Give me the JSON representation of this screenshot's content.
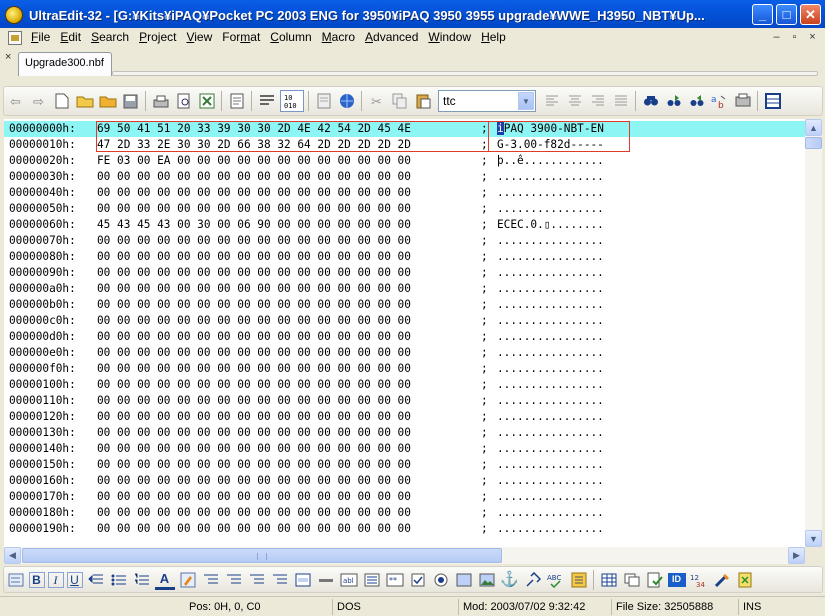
{
  "window": {
    "title": "UltraEdit-32 - [G:¥Kits¥iPAQ¥Pocket PC 2003 ENG for 3950¥iPAQ 3950 3955 upgrade¥WWE_H3950_NBT¥Up..."
  },
  "window_buttons": {
    "minimize": "_",
    "maximize": "□",
    "close": "✕"
  },
  "menu": [
    "File",
    "Edit",
    "Search",
    "Project",
    "View",
    "Format",
    "Column",
    "Macro",
    "Advanced",
    "Window",
    "Help"
  ],
  "menu_accel": [
    "F",
    "E",
    "S",
    "P",
    "V",
    "m",
    "C",
    "M",
    "A",
    "W",
    "H"
  ],
  "mdi_buttons": [
    "–",
    "▫",
    "×"
  ],
  "tab": {
    "close": "×",
    "label": "Upgrade300.nbf"
  },
  "find": {
    "value": "ttc"
  },
  "hex": {
    "separator": ";",
    "rows": [
      {
        "offset": "00000000h:",
        "bytes": "69 50 41 51 20 33 39 30 30 2D 4E 42 54 2D 45 4E",
        "ascii": "iPAQ 3900-NBT-EN"
      },
      {
        "offset": "00000010h:",
        "bytes": "47 2D 33 2E 30 30 2D 66 38 32 64 2D 2D 2D 2D 2D",
        "ascii": "G-3.00-f82d-----"
      },
      {
        "offset": "00000020h:",
        "bytes": "FE 03 00 EA 00 00 00 00 00 00 00 00 00 00 00 00",
        "ascii": "þ..ê............"
      },
      {
        "offset": "00000030h:",
        "bytes": "00 00 00 00 00 00 00 00 00 00 00 00 00 00 00 00",
        "ascii": "................"
      },
      {
        "offset": "00000040h:",
        "bytes": "00 00 00 00 00 00 00 00 00 00 00 00 00 00 00 00",
        "ascii": "................"
      },
      {
        "offset": "00000050h:",
        "bytes": "00 00 00 00 00 00 00 00 00 00 00 00 00 00 00 00",
        "ascii": "................"
      },
      {
        "offset": "00000060h:",
        "bytes": "45 43 45 43 00 30 00 06 90 00 00 00 00 00 00 00",
        "ascii": "ECEC.0.▯........"
      },
      {
        "offset": "00000070h:",
        "bytes": "00 00 00 00 00 00 00 00 00 00 00 00 00 00 00 00",
        "ascii": "................"
      },
      {
        "offset": "00000080h:",
        "bytes": "00 00 00 00 00 00 00 00 00 00 00 00 00 00 00 00",
        "ascii": "................"
      },
      {
        "offset": "00000090h:",
        "bytes": "00 00 00 00 00 00 00 00 00 00 00 00 00 00 00 00",
        "ascii": "................"
      },
      {
        "offset": "000000a0h:",
        "bytes": "00 00 00 00 00 00 00 00 00 00 00 00 00 00 00 00",
        "ascii": "................"
      },
      {
        "offset": "000000b0h:",
        "bytes": "00 00 00 00 00 00 00 00 00 00 00 00 00 00 00 00",
        "ascii": "................"
      },
      {
        "offset": "000000c0h:",
        "bytes": "00 00 00 00 00 00 00 00 00 00 00 00 00 00 00 00",
        "ascii": "................"
      },
      {
        "offset": "000000d0h:",
        "bytes": "00 00 00 00 00 00 00 00 00 00 00 00 00 00 00 00",
        "ascii": "................"
      },
      {
        "offset": "000000e0h:",
        "bytes": "00 00 00 00 00 00 00 00 00 00 00 00 00 00 00 00",
        "ascii": "................"
      },
      {
        "offset": "000000f0h:",
        "bytes": "00 00 00 00 00 00 00 00 00 00 00 00 00 00 00 00",
        "ascii": "................"
      },
      {
        "offset": "00000100h:",
        "bytes": "00 00 00 00 00 00 00 00 00 00 00 00 00 00 00 00",
        "ascii": "................"
      },
      {
        "offset": "00000110h:",
        "bytes": "00 00 00 00 00 00 00 00 00 00 00 00 00 00 00 00",
        "ascii": "................"
      },
      {
        "offset": "00000120h:",
        "bytes": "00 00 00 00 00 00 00 00 00 00 00 00 00 00 00 00",
        "ascii": "................"
      },
      {
        "offset": "00000130h:",
        "bytes": "00 00 00 00 00 00 00 00 00 00 00 00 00 00 00 00",
        "ascii": "................"
      },
      {
        "offset": "00000140h:",
        "bytes": "00 00 00 00 00 00 00 00 00 00 00 00 00 00 00 00",
        "ascii": "................"
      },
      {
        "offset": "00000150h:",
        "bytes": "00 00 00 00 00 00 00 00 00 00 00 00 00 00 00 00",
        "ascii": "................"
      },
      {
        "offset": "00000160h:",
        "bytes": "00 00 00 00 00 00 00 00 00 00 00 00 00 00 00 00",
        "ascii": "................"
      },
      {
        "offset": "00000170h:",
        "bytes": "00 00 00 00 00 00 00 00 00 00 00 00 00 00 00 00",
        "ascii": "................"
      },
      {
        "offset": "00000180h:",
        "bytes": "00 00 00 00 00 00 00 00 00 00 00 00 00 00 00 00",
        "ascii": "................"
      },
      {
        "offset": "00000190h:",
        "bytes": "00 00 00 00 00 00 00 00 00 00 00 00 00 00 00 00",
        "ascii": "................"
      }
    ]
  },
  "status": {
    "position": "Pos: 0H, 0, C0",
    "format": "DOS",
    "modified": "Mod: 2003/07/02 9:32:42",
    "file_size": "File Size: 32505888",
    "mode": "INS"
  },
  "colors": {
    "title_bar": "#0352d8",
    "current_line": "#8ef5f5",
    "highlight_box": "#e03a2b",
    "menu_bg": "#ece9d8"
  }
}
